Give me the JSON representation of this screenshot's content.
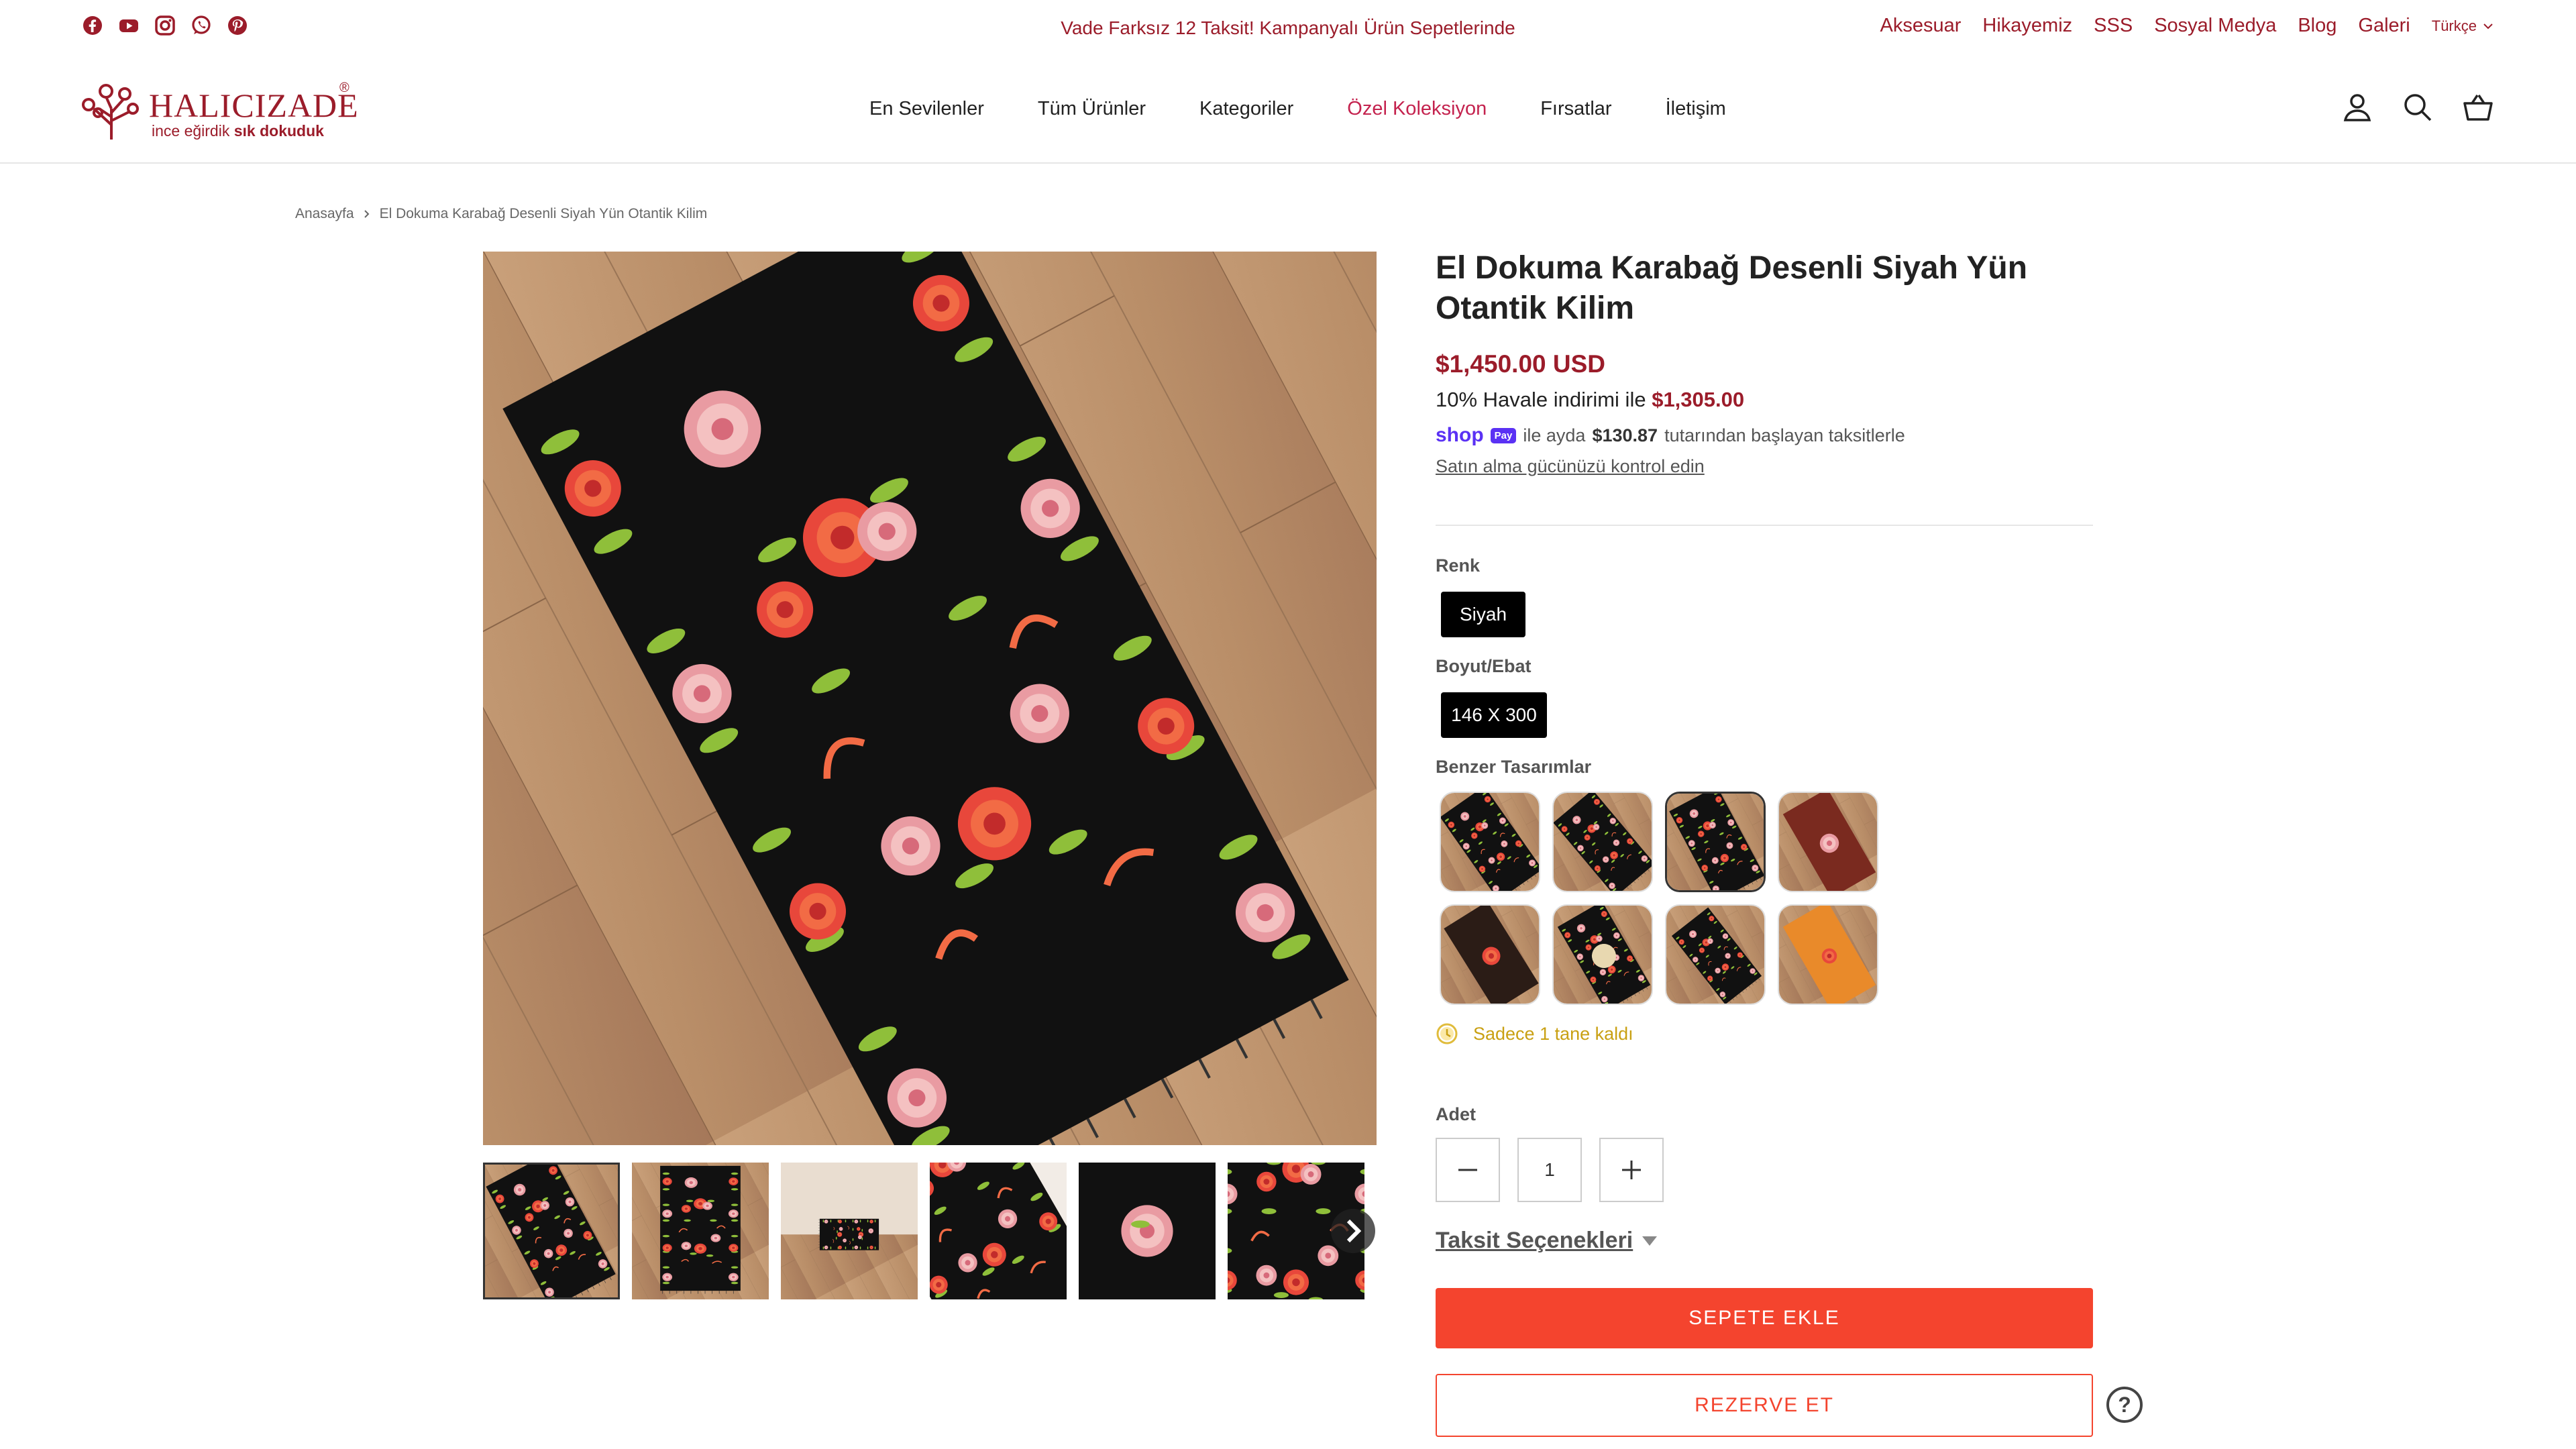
{
  "topbar": {
    "social": [
      "facebook-icon",
      "youtube-icon",
      "instagram-icon",
      "whatsapp-icon",
      "pinterest-icon"
    ],
    "announcement": "Vade Farksız 12 Taksit! Kampanyalı Ürün Sepetlerinde",
    "links": [
      "Aksesuar",
      "Hikayemiz",
      "SSS",
      "Sosyal Medya",
      "Blog",
      "Galeri"
    ],
    "language": "Türkçe"
  },
  "header": {
    "logo_name": "HALICIZADE",
    "logo_reg": "®",
    "logo_tag_light": "ince eğirdik",
    "logo_tag_bold": "sık dokuduk",
    "nav": [
      "En Sevilenler",
      "Tüm Ürünler",
      "Kategoriler",
      "Özel Koleksiyon",
      "Fırsatlar",
      "İletişim"
    ],
    "icons": [
      "account-icon",
      "search-icon",
      "basket-icon"
    ]
  },
  "breadcrumb": {
    "home": "Anasayfa",
    "current": "El Dokuma Karabağ Desenli Siyah Yün Otantik Kilim"
  },
  "product": {
    "title": "El Dokuma Karabağ Desenli Siyah Yün Otantik Kilim",
    "price": "$1,450.00 USD",
    "havale_text": "10% Havale indirimi ile",
    "havale_price": "$1,305.00",
    "shoppay_brand": "shop",
    "shoppay_badge": "Pay",
    "shoppay_pre": "ile ayda",
    "shoppay_amount": "$130.87",
    "shoppay_post": "tutarından başlayan taksitlerle",
    "check_link": "Satın alma gücünüzü kontrol edin",
    "color_label": "Renk",
    "color_value": "Siyah",
    "size_label": "Boyut/Ebat",
    "size_value": "146 X 300",
    "similar_label": "Benzer Tasarımlar",
    "stock_text": "Sadece 1 tane kaldı",
    "qty_label": "Adet",
    "qty_value": "1",
    "taksit_label": "Taksit Seçenekleri",
    "add_to_cart": "SEPETE EKLE",
    "reserve": "REZERVE ET"
  },
  "colors": {
    "brand": "#9b1c2a",
    "accent_nav": "#c4224e",
    "cta": "#f4442e",
    "stock": "#c9a013",
    "shoppay": "#5a31f4"
  }
}
